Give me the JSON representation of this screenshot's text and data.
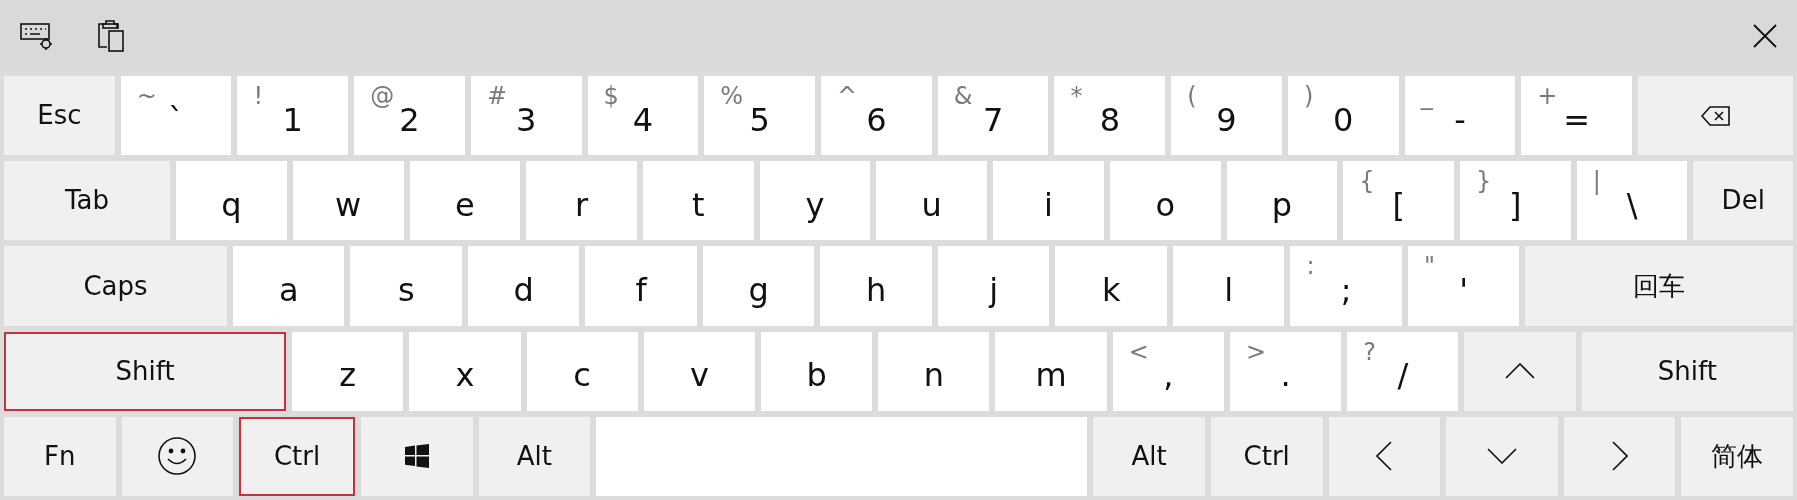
{
  "rows": [
    [
      {
        "kind": "func",
        "label": "Esc",
        "highlighted": false
      },
      {
        "kind": "char",
        "shift": "~",
        "main": "`"
      },
      {
        "kind": "char",
        "shift": "!",
        "main": "1"
      },
      {
        "kind": "char",
        "shift": "@",
        "main": "2"
      },
      {
        "kind": "char",
        "shift": "#",
        "main": "3"
      },
      {
        "kind": "char",
        "shift": "$",
        "main": "4"
      },
      {
        "kind": "char",
        "shift": "%",
        "main": "5"
      },
      {
        "kind": "char",
        "shift": "^",
        "main": "6"
      },
      {
        "kind": "char",
        "shift": "&",
        "main": "7"
      },
      {
        "kind": "char",
        "shift": "*",
        "main": "8"
      },
      {
        "kind": "char",
        "shift": "(",
        "main": "9"
      },
      {
        "kind": "char",
        "shift": ")",
        "main": "0"
      },
      {
        "kind": "char",
        "shift": "_",
        "main": "-"
      },
      {
        "kind": "char",
        "shift": "+",
        "main": "="
      },
      {
        "kind": "backspace"
      }
    ],
    [
      {
        "kind": "func",
        "label": "Tab",
        "highlighted": false
      },
      {
        "kind": "char",
        "main": "q"
      },
      {
        "kind": "char",
        "main": "w"
      },
      {
        "kind": "char",
        "main": "e"
      },
      {
        "kind": "char",
        "main": "r"
      },
      {
        "kind": "char",
        "main": "t"
      },
      {
        "kind": "char",
        "main": "y"
      },
      {
        "kind": "char",
        "main": "u"
      },
      {
        "kind": "char",
        "main": "i"
      },
      {
        "kind": "char",
        "main": "o"
      },
      {
        "kind": "char",
        "main": "p"
      },
      {
        "kind": "char",
        "shift": "{",
        "main": "["
      },
      {
        "kind": "char",
        "shift": "}",
        "main": "]"
      },
      {
        "kind": "char",
        "shift": "|",
        "main": "\\"
      },
      {
        "kind": "func",
        "label": "Del",
        "highlighted": false
      }
    ],
    [
      {
        "kind": "func",
        "label": "Caps",
        "highlighted": false
      },
      {
        "kind": "char",
        "main": "a"
      },
      {
        "kind": "char",
        "main": "s"
      },
      {
        "kind": "char",
        "main": "d"
      },
      {
        "kind": "char",
        "main": "f"
      },
      {
        "kind": "char",
        "main": "g"
      },
      {
        "kind": "char",
        "main": "h"
      },
      {
        "kind": "char",
        "main": "j"
      },
      {
        "kind": "char",
        "main": "k"
      },
      {
        "kind": "char",
        "main": "l"
      },
      {
        "kind": "char",
        "shift": ":",
        "main": ";"
      },
      {
        "kind": "char",
        "shift": "\"",
        "main": "'"
      },
      {
        "kind": "func",
        "label": "回车",
        "highlighted": false
      }
    ],
    [
      {
        "kind": "func",
        "label": "Shift",
        "highlighted": true
      },
      {
        "kind": "char",
        "main": "z"
      },
      {
        "kind": "char",
        "main": "x"
      },
      {
        "kind": "char",
        "main": "c"
      },
      {
        "kind": "char",
        "main": "v"
      },
      {
        "kind": "char",
        "main": "b"
      },
      {
        "kind": "char",
        "main": "n"
      },
      {
        "kind": "char",
        "main": "m"
      },
      {
        "kind": "char",
        "shift": "<",
        "main": ","
      },
      {
        "kind": "char",
        "shift": ">",
        "main": "."
      },
      {
        "kind": "char",
        "shift": "?",
        "main": "/"
      },
      {
        "kind": "up"
      },
      {
        "kind": "func",
        "label": "Shift",
        "highlighted": false
      }
    ],
    [
      {
        "kind": "func",
        "label": "Fn",
        "highlighted": false
      },
      {
        "kind": "emoji"
      },
      {
        "kind": "func",
        "label": "Ctrl",
        "highlighted": true
      },
      {
        "kind": "windows"
      },
      {
        "kind": "func",
        "label": "Alt",
        "highlighted": false
      },
      {
        "kind": "space"
      },
      {
        "kind": "func",
        "label": "Alt",
        "highlighted": false
      },
      {
        "kind": "func",
        "label": "Ctrl",
        "highlighted": false
      },
      {
        "kind": "left"
      },
      {
        "kind": "down"
      },
      {
        "kind": "right"
      },
      {
        "kind": "func",
        "label": "简体",
        "highlighted": false
      }
    ]
  ]
}
